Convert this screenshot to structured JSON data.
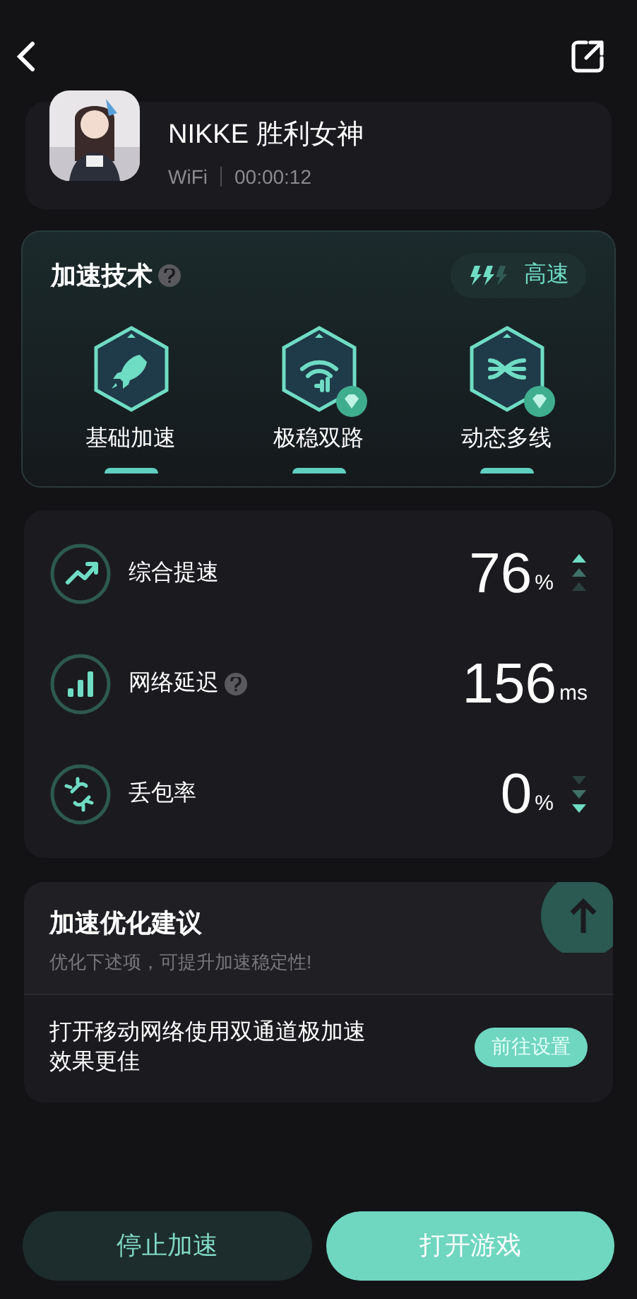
{
  "game": {
    "name": "NIKKE 胜利女神",
    "network": "WiFi",
    "elapsed": "00:00:12"
  },
  "tech": {
    "title": "加速技术",
    "speed_label": "高速",
    "level": 0.67,
    "items": [
      {
        "label": "基础加速",
        "premium": false
      },
      {
        "label": "极稳双路",
        "premium": true
      },
      {
        "label": "动态多线",
        "premium": true
      }
    ]
  },
  "stats": [
    {
      "kind": "up",
      "label": "综合提速",
      "help": false,
      "value": "76",
      "unit": "%"
    },
    {
      "kind": "flat",
      "label": "网络延迟",
      "help": true,
      "value": "156",
      "unit": "ms"
    },
    {
      "kind": "down",
      "label": "丢包率",
      "help": false,
      "value": "0",
      "unit": "%"
    }
  ],
  "suggestions": {
    "title": "加速优化建议",
    "subtitle": "优化下述项，可提升加速稳定性!",
    "items": [
      {
        "text": "打开移动网络使用双通道极加速效果更佳",
        "action": "前往设置"
      }
    ]
  },
  "buttons": {
    "stop": "停止加速",
    "open": "打开游戏"
  }
}
